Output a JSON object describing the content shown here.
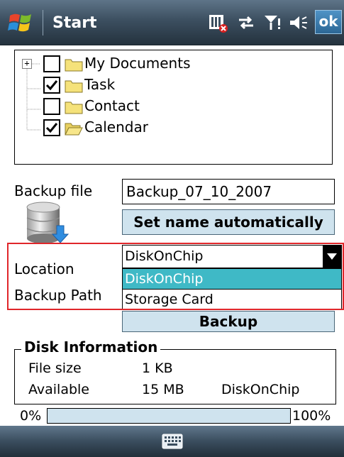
{
  "titlebar": {
    "title": "Start",
    "ok_label": "ok",
    "icons": [
      "windows-logo",
      "sim-missing-icon",
      "data-connection-icon",
      "signal-icon",
      "volume-icon"
    ]
  },
  "tree": {
    "items": [
      {
        "label": "My Documents",
        "checked": false,
        "expandable": true
      },
      {
        "label": "Task",
        "checked": true,
        "expandable": false
      },
      {
        "label": "Contact",
        "checked": false,
        "expandable": false
      },
      {
        "label": "Calendar",
        "checked": true,
        "expandable": false
      }
    ]
  },
  "form": {
    "backup_file_label": "Backup file",
    "backup_file_value": "Backup_07_10_2007",
    "set_name_button": "Set name automatically",
    "location_label": "Location",
    "backup_path_label": "Backup Path",
    "location_value": "DiskOnChip",
    "location_options": [
      "DiskOnChip",
      "Storage Card"
    ],
    "backup_button": "Backup"
  },
  "disk_info": {
    "title": "Disk Information",
    "file_size_label": "File size",
    "file_size_value": "1 KB",
    "available_label": "Available",
    "available_value": "15 MB",
    "available_device": "DiskOnChip"
  },
  "progress": {
    "min_label": "0%",
    "max_label": "100%",
    "value": 0
  },
  "colors": {
    "accent": "#3fb9c6",
    "button_bg": "#cfe3ee",
    "highlight_border": "#e0262a"
  }
}
